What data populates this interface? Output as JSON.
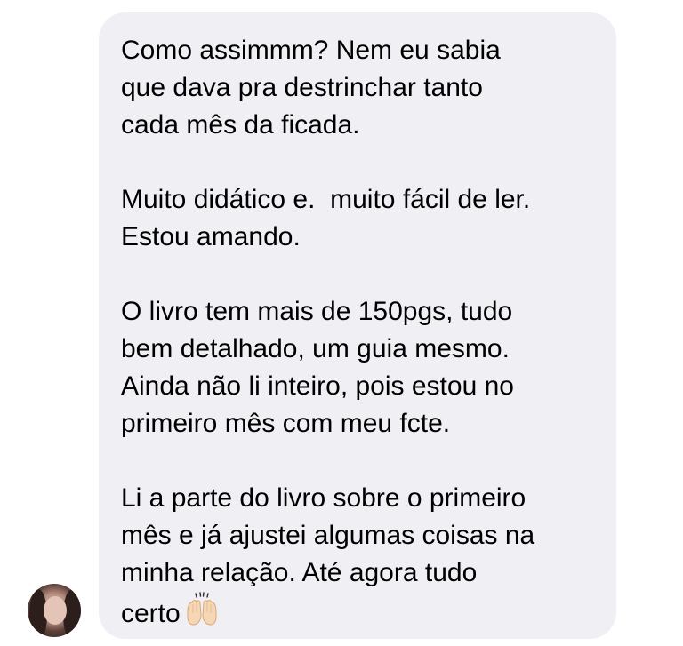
{
  "message": {
    "paragraphs": [
      "Como assimmm? Nem eu sabia\nque dava pra destrinchar tanto\ncada mês da ficada.",
      "Muito didático e.  muito fácil de ler.\nEstou amando.",
      "O livro tem mais de 150pgs, tudo\nbem detalhado, um guia mesmo.\nAinda não li inteiro, pois estou no\nprimeiro mês com meu fcte."
    ],
    "last_paragraph_lines": [
      "Li a parte do livro sobre o primeiro",
      "mês e já ajustei algumas coisas na",
      "minha relação. Até agora tudo",
      "certo"
    ],
    "emoji": "raising-hands-icon",
    "bubble_color": "#efeff4"
  },
  "sender": {
    "avatar": "avatar-photo"
  }
}
